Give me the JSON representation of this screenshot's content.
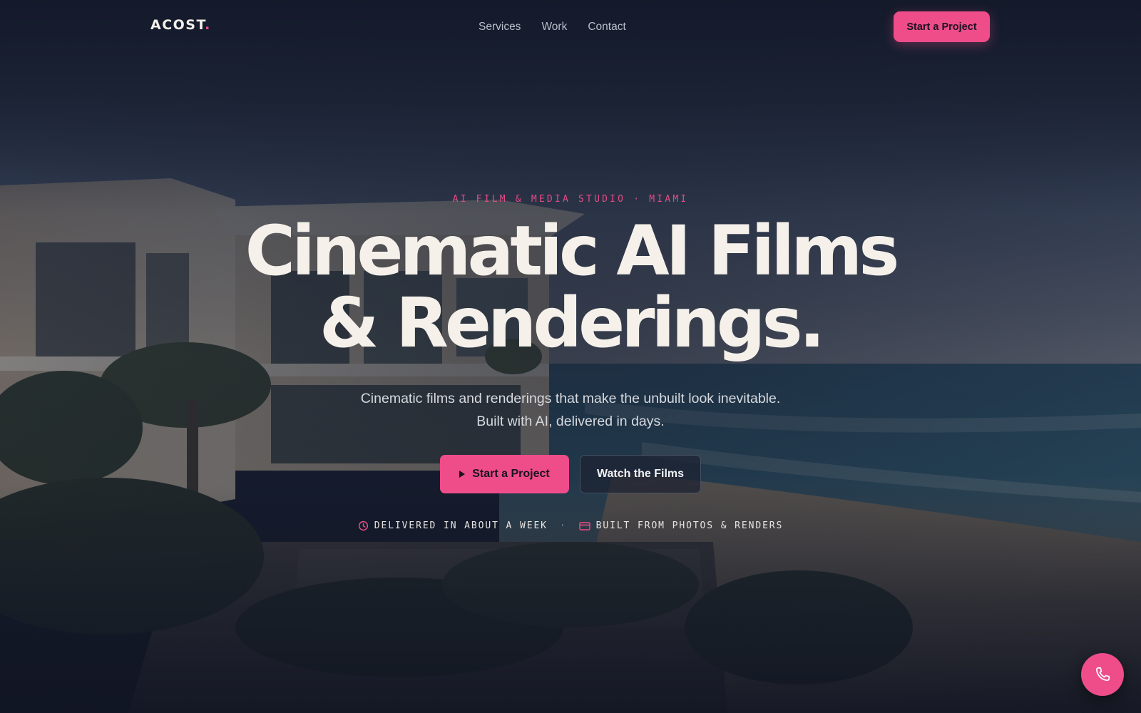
{
  "nav": {
    "logo_text": "ACOST",
    "logo_dot": ".",
    "links": [
      "Services",
      "Work",
      "Contact"
    ],
    "cta_label": "Start a Project"
  },
  "hero": {
    "eyebrow": "AI FILM & MEDIA STUDIO · MIAMI",
    "headline_line1": "Cinematic AI Films",
    "headline_line2": "& Renderings.",
    "subhead_line1": "Cinematic films and renderings that make the unbuilt look inevitable.",
    "subhead_line2": "Built with AI, delivered in days.",
    "primary_cta": "Start a Project",
    "secondary_cta": "Watch the Films",
    "badges": [
      {
        "icon": "clock-icon",
        "label": "DELIVERED IN ABOUT A WEEK"
      },
      {
        "icon": "credit-card-icon",
        "label": "BUILT FROM PHOTOS & RENDERS"
      }
    ],
    "badge_separator": "·"
  },
  "floating": {
    "icon": "phone-icon"
  },
  "colors": {
    "accent": "#ee4d8a",
    "background": "#141a2a",
    "headline": "#f5f1ea"
  }
}
